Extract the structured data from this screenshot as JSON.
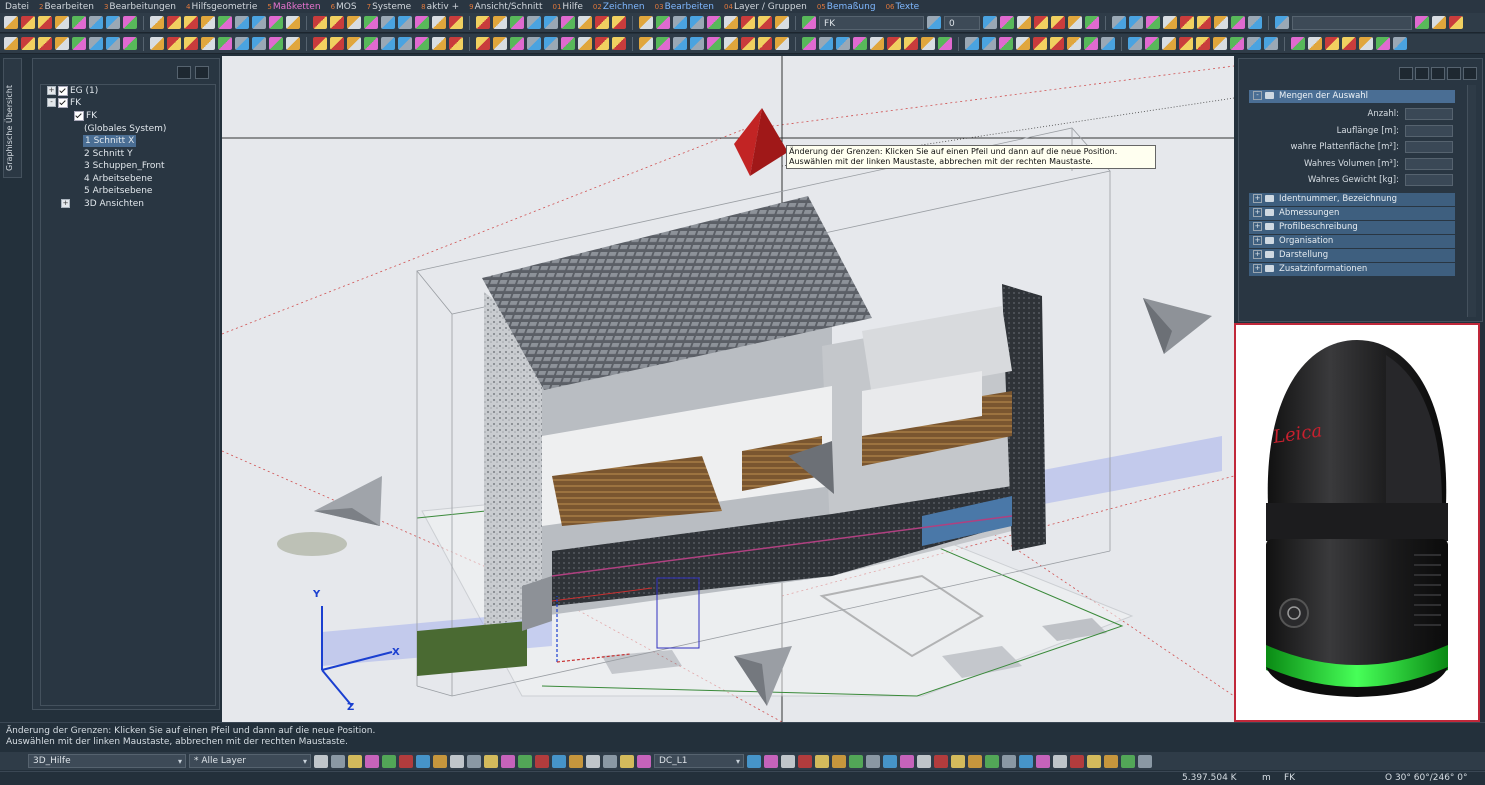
{
  "menu": [
    {
      "num": "",
      "label": "Datei",
      "style": ""
    },
    {
      "num": "2",
      "label": "Bearbeiten",
      "style": ""
    },
    {
      "num": "3",
      "label": "Bearbeitungen",
      "style": ""
    },
    {
      "num": "4",
      "label": "Hilfsgeometrie",
      "style": ""
    },
    {
      "num": "5",
      "label": "Maßketten",
      "style": "hl"
    },
    {
      "num": "6",
      "label": "MOS",
      "style": ""
    },
    {
      "num": "7",
      "label": "Systeme",
      "style": ""
    },
    {
      "num": "8",
      "label": "aktiv +",
      "style": ""
    },
    {
      "num": "9",
      "label": "Ansicht/Schnitt",
      "style": ""
    },
    {
      "num": "01",
      "label": "Hilfe",
      "style": ""
    },
    {
      "num": "02",
      "label": "Zeichnen",
      "style": "hl2"
    },
    {
      "num": "03",
      "label": "Bearbeiten",
      "style": "hl2"
    },
    {
      "num": "04",
      "label": "Layer / Gruppen",
      "style": ""
    },
    {
      "num": "05",
      "label": "Bemaßung",
      "style": "hl2"
    },
    {
      "num": "06",
      "label": "Texte",
      "style": "hl2"
    }
  ],
  "toolbar": {
    "system_value": "FK",
    "number_value": "0",
    "layer_field_value": ""
  },
  "side_tab": {
    "label": "Graphische Übersicht"
  },
  "tree": {
    "eg": "EG (1)",
    "fk": "FK",
    "fk_child": "FK",
    "global": "(Globales System)",
    "items": [
      "1 Schnitt X",
      "2 Schnitt Y",
      "3 Schuppen_Front",
      "4 Arbeitsebene",
      "5 Arbeitsebene"
    ],
    "views": "3D Ansichten"
  },
  "tooltip": {
    "line1": "Änderung der Grenzen: Klicken Sie auf einen Pfeil und dann auf die neue Position.",
    "line2": "Auswählen mit der linken Maustaste, abbrechen mit der rechten Maustaste."
  },
  "axes": {
    "x": "X",
    "y": "Y",
    "z": "Z"
  },
  "properties": {
    "header": "Mengen der Auswahl",
    "fields": [
      {
        "label": "Anzahl:",
        "value": ""
      },
      {
        "label": "Lauflänge [m]:",
        "value": ""
      },
      {
        "label": "wahre Plattenfläche [m²]:",
        "value": ""
      },
      {
        "label": "Wahres Volumen [m³]:",
        "value": ""
      },
      {
        "label": "Wahres Gewicht [kg]:",
        "value": ""
      }
    ],
    "groups": [
      "Identnummer, Bezeichnung",
      "Abmessungen",
      "Profilbeschreibung",
      "Organisation",
      "Darstellung",
      "Zusatzinformationen"
    ]
  },
  "scanner": {
    "brand": "Leica"
  },
  "status": {
    "line1": "Änderung der Grenzen: Klicken Sie auf einen Pfeil und dann auf die neue Position.",
    "line2": "Auswählen mit der linken Maustaste, abbrechen mit der rechten Maustaste."
  },
  "bottombar": {
    "mode": "3D_Hilfe",
    "layer": "* Alle Layer",
    "dc": "DC_L1"
  },
  "coords": {
    "value": "5.397.504 K",
    "unit": "m",
    "system": "FK",
    "angles": "O 30° 60°/246° 0°"
  },
  "colors": {
    "accent": "#4a6e94",
    "scanner_ring": "#33ff44",
    "frame": "#c0283a"
  }
}
